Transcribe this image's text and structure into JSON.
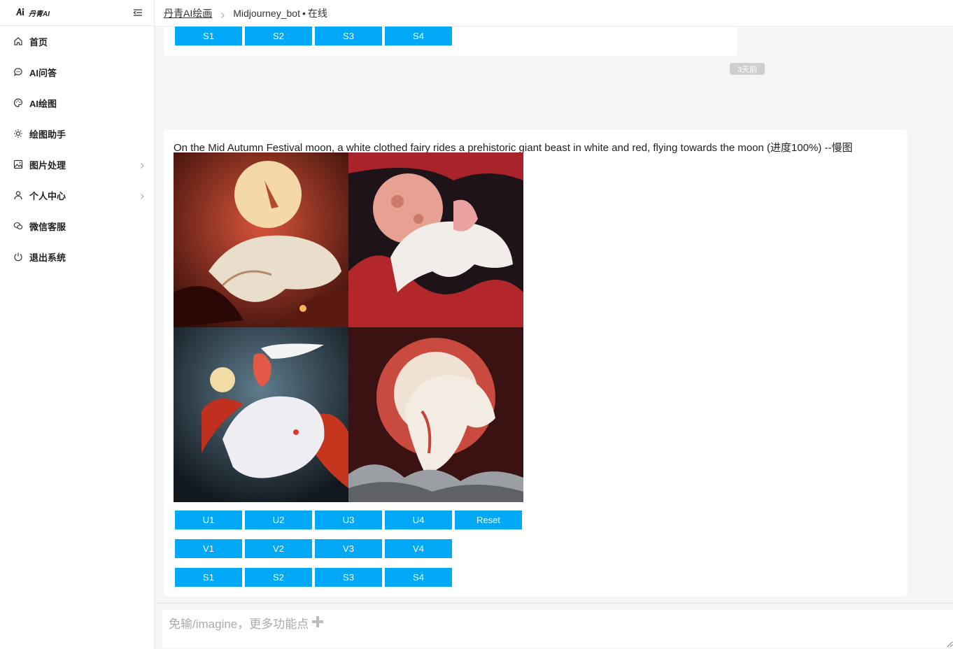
{
  "sidebar": {
    "logo_text": "丹青AI",
    "items": [
      {
        "label": "首页",
        "icon": "home-icon"
      },
      {
        "label": "AI问答",
        "icon": "chat-bubble-icon"
      },
      {
        "label": "AI绘图",
        "icon": "palette-icon"
      },
      {
        "label": "绘图助手",
        "icon": "bulb-icon"
      },
      {
        "label": "图片处理",
        "icon": "image-icon",
        "has_submenu": true
      },
      {
        "label": "个人中心",
        "icon": "user-icon",
        "has_submenu": true
      },
      {
        "label": "微信客服",
        "icon": "wechat-icon"
      },
      {
        "label": "退出系统",
        "icon": "power-icon"
      }
    ]
  },
  "header": {
    "breadcrumb_link": "丹青AI绘画",
    "bot_name": "Midjourney_bot",
    "separator": "•",
    "status": "在线"
  },
  "messages": {
    "top_buttons": [
      "S1",
      "S2",
      "S3",
      "S4"
    ],
    "time_badge": "3天前",
    "prompt": "On the Mid Autumn Festival moon, a white clothed fairy rides a prehistoric giant beast in white and red, flying towards the moon (进度100%) --慢图",
    "upscale_buttons": [
      "U1",
      "U2",
      "U3",
      "U4",
      "Reset"
    ],
    "variation_buttons": [
      "V1",
      "V2",
      "V3",
      "V4"
    ],
    "style_buttons": [
      "S1",
      "S2",
      "S3",
      "S4"
    ]
  },
  "input": {
    "placeholder": "免输/imagine，更多功能点",
    "plus_icon": "plus-icon"
  },
  "colors": {
    "accent": "#00a8f5",
    "background": "#f5f5f5"
  }
}
